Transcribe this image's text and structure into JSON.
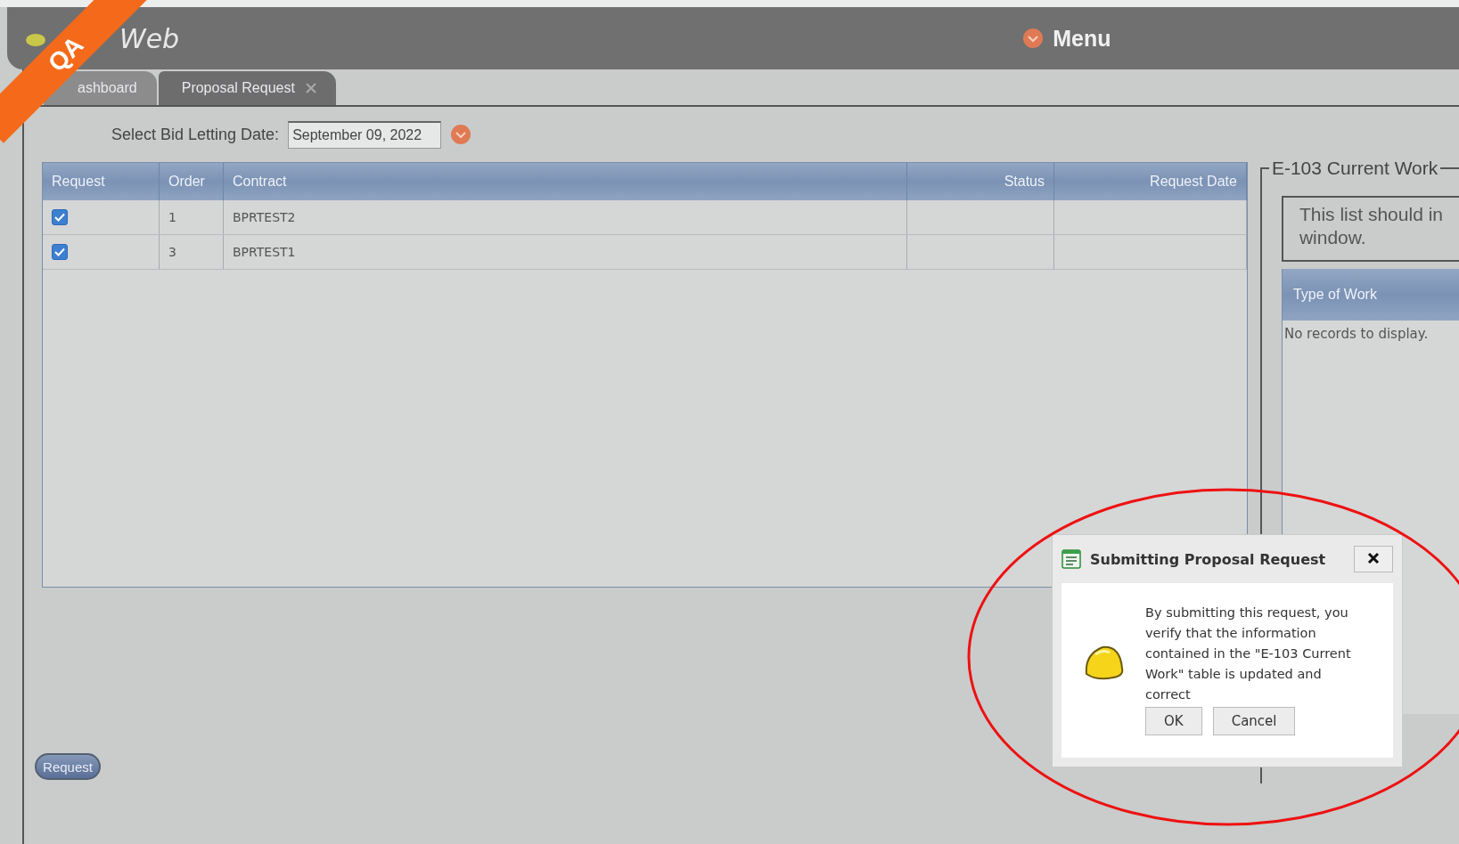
{
  "ribbon": {
    "label": "QA"
  },
  "header": {
    "logo_text": "Web",
    "menu_label": "Menu"
  },
  "tabs": [
    {
      "label": "ashboard",
      "selected": false
    },
    {
      "label": "Proposal Request",
      "selected": true
    }
  ],
  "date_picker": {
    "label": "Select Bid Letting Date:",
    "value": "September 09, 2022"
  },
  "table": {
    "columns": [
      "Request",
      "Order",
      "Contract",
      "Status",
      "Request Date"
    ],
    "rows": [
      {
        "checked": true,
        "order": "1",
        "contract": "BPRTEST2"
      },
      {
        "checked": true,
        "order": "3",
        "contract": "BPRTEST1"
      }
    ]
  },
  "request_button": "Request",
  "side_panel": {
    "legend": "E-103 Current Work",
    "note_lines": [
      "This list should in",
      "window."
    ],
    "columns": [
      "Type of Work"
    ],
    "empty_text": "No records to display."
  },
  "dialog": {
    "title": "Submitting Proposal Request",
    "message": "By submitting this request, you verify that the information contained in the \"E-103 Current Work\" table is updated and correct",
    "buttons": [
      "OK",
      "Cancel"
    ]
  }
}
